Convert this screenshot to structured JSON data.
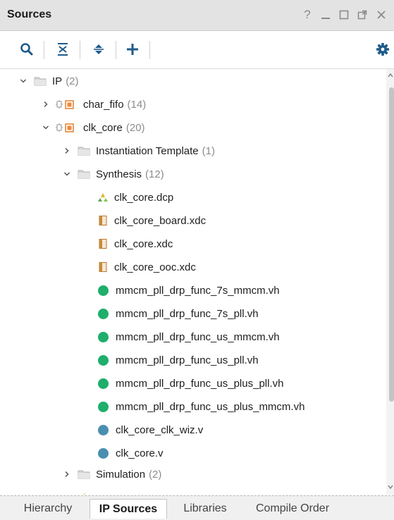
{
  "window": {
    "title": "Sources",
    "controls": {
      "help": "?",
      "minimize_icon": "minimize-icon",
      "maximize_icon": "maximize-icon",
      "float_icon": "float-icon",
      "close_icon": "close-icon"
    }
  },
  "toolbar": {
    "items": [
      {
        "icon": "search-icon"
      },
      {
        "icon": "collapse-all-icon"
      },
      {
        "icon": "expand-all-icon"
      },
      {
        "icon": "add-icon"
      },
      {
        "icon": "gear-icon"
      }
    ]
  },
  "tree": {
    "nodes": [
      {
        "label": "IP",
        "count": "(2)",
        "level": 0,
        "expanded": true,
        "icon": "folder-icon"
      },
      {
        "label": "char_fifo",
        "count": "(14)",
        "level": 1,
        "expanded": false,
        "icon": "ip-core-icon"
      },
      {
        "label": "clk_core",
        "count": "(20)",
        "level": 1,
        "expanded": true,
        "icon": "ip-core-icon"
      },
      {
        "label": "Instantiation Template",
        "count": "(1)",
        "level": 2,
        "expanded": false,
        "icon": "folder-icon"
      },
      {
        "label": "Synthesis",
        "count": "(12)",
        "level": 2,
        "expanded": true,
        "icon": "folder-icon"
      },
      {
        "label": "clk_core.dcp",
        "level": 3,
        "icon": "dcp-file-icon"
      },
      {
        "label": "clk_core_board.xdc",
        "level": 3,
        "icon": "constraints-file-icon"
      },
      {
        "label": "clk_core.xdc",
        "level": 3,
        "icon": "constraints-file-icon"
      },
      {
        "label": "clk_core_ooc.xdc",
        "level": 3,
        "icon": "constraints-file-icon"
      },
      {
        "label": "mmcm_pll_drp_func_7s_mmcm.vh",
        "level": 3,
        "icon": "verilog-header-icon"
      },
      {
        "label": "mmcm_pll_drp_func_7s_pll.vh",
        "level": 3,
        "icon": "verilog-header-icon"
      },
      {
        "label": "mmcm_pll_drp_func_us_mmcm.vh",
        "level": 3,
        "icon": "verilog-header-icon"
      },
      {
        "label": "mmcm_pll_drp_func_us_pll.vh",
        "level": 3,
        "icon": "verilog-header-icon"
      },
      {
        "label": "mmcm_pll_drp_func_us_plus_pll.vh",
        "level": 3,
        "icon": "verilog-header-icon"
      },
      {
        "label": "mmcm_pll_drp_func_us_plus_mmcm.vh",
        "level": 3,
        "icon": "verilog-header-icon"
      },
      {
        "label": "clk_core_clk_wiz.v",
        "level": 3,
        "icon": "verilog-file-icon"
      },
      {
        "label": "clk_core.v",
        "level": 3,
        "icon": "verilog-file-icon"
      },
      {
        "label": "Simulation",
        "count": "(2)",
        "level": 2,
        "expanded": false,
        "icon": "folder-icon"
      }
    ]
  },
  "tabs": [
    {
      "label": "Hierarchy",
      "active": false
    },
    {
      "label": "IP Sources",
      "active": true
    },
    {
      "label": "Libraries",
      "active": false
    },
    {
      "label": "Compile Order",
      "active": false
    }
  ],
  "colors": {
    "verilog_header": "#1fae6b",
    "verilog_file": "#4a8fb0",
    "ip_core": "#f0883a",
    "toolbar_icon": "#1e5a8a"
  }
}
